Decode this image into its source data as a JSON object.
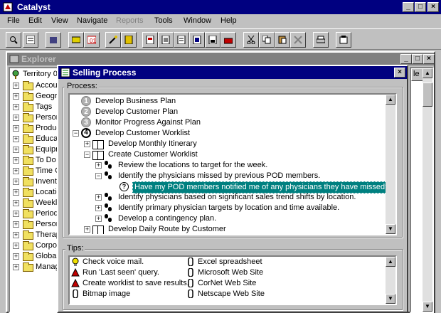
{
  "app": {
    "title": "Catalyst"
  },
  "menu": {
    "items": [
      "File",
      "Edit",
      "View",
      "Navigate",
      "Reports",
      "Tools",
      "Window",
      "Help"
    ]
  },
  "explorer": {
    "title": "Explorer",
    "root": "Territory 0",
    "items": [
      "Accou",
      "Geogra",
      "Tags",
      "Persor",
      "Produc",
      "Educa",
      "Equipn",
      "To Do",
      "Time O",
      "Invent",
      "Locatio",
      "Weekl",
      "Period",
      "Persor",
      "Therap",
      "Corpor",
      "Global",
      "Manag"
    ],
    "right_header": "le"
  },
  "dialog": {
    "title": "Selling Process",
    "process_label": "Process:",
    "tips_label": "Tips:",
    "steps": [
      {
        "num": "1",
        "label": "Develop Business Plan"
      },
      {
        "num": "2",
        "label": "Develop Customer Plan"
      },
      {
        "num": "3",
        "label": "Monitor Progress Against Plan"
      },
      {
        "num": "4",
        "label": "Develop Customer Worklist"
      }
    ],
    "sub": [
      "Develop Monthly Itinerary",
      "Create Customer Worklist",
      "Review the locations to target for the week.",
      "Identify the physicians missed by previous POD members.",
      "Have my POD members notified me of any physicians they have missed?",
      "Identify physicians based on significant sales trend shifts by location.",
      "Identify primary physician targets by location and time available.",
      "Develop a contingency plan.",
      "Develop Daily Route by Customer"
    ],
    "tips_left": [
      "Check voice mail.",
      "Run 'Last seen' query.",
      "Create worklist to save results.",
      "Bitmap image"
    ],
    "tips_right": [
      "Excel spreadsheet",
      "Microsoft Web Site",
      "CorNet Web Site",
      "Netscape Web Site"
    ]
  }
}
